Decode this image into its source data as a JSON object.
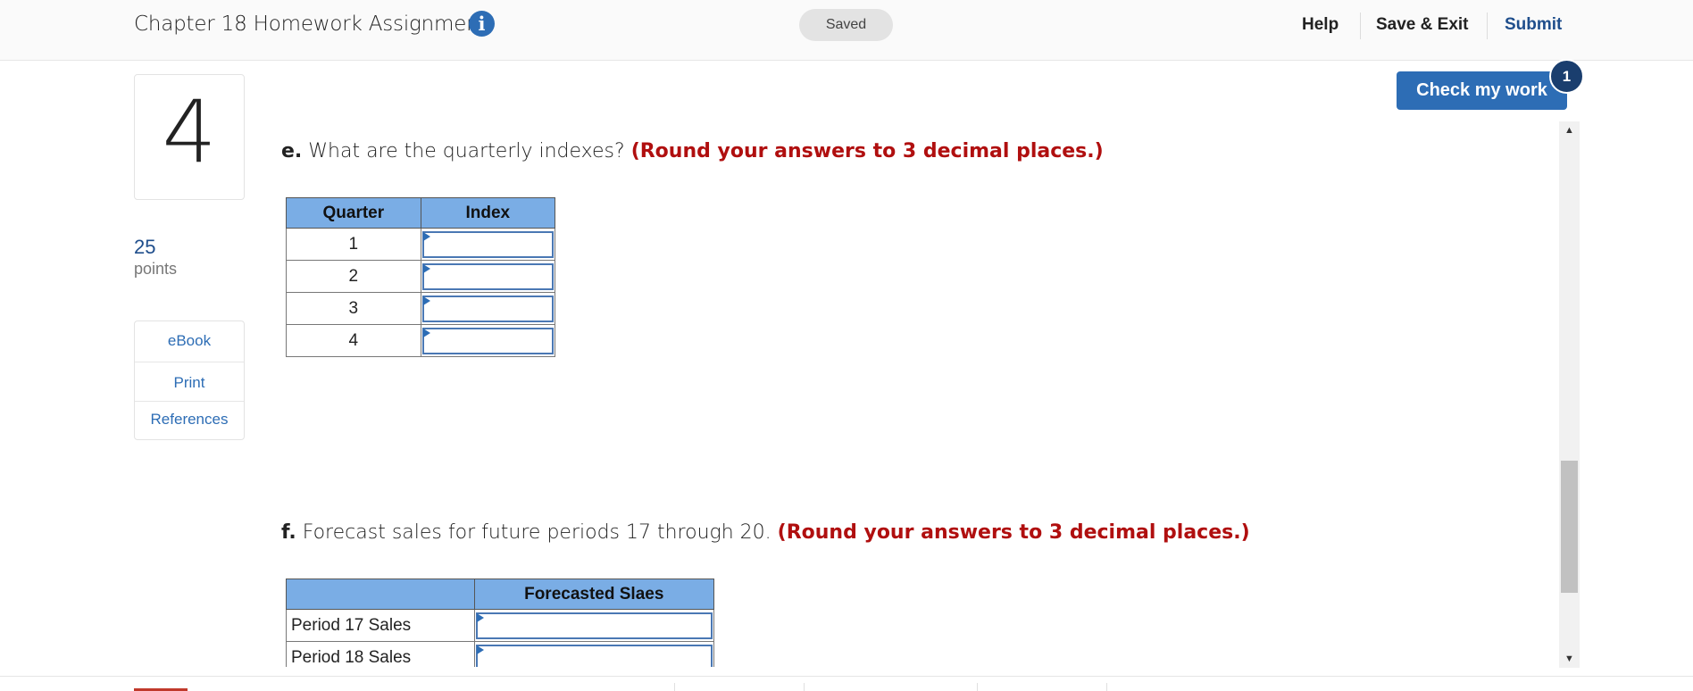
{
  "header": {
    "title": "Chapter 18 Homework Assignment",
    "info_icon": "i",
    "saved": "Saved",
    "help": "Help",
    "save_exit": "Save & Exit",
    "submit": "Submit"
  },
  "question": {
    "number": "4",
    "points_value": "25",
    "points_label": "points"
  },
  "side_links": {
    "ebook": "eBook",
    "print": "Print",
    "references": "References"
  },
  "check_work": {
    "label": "Check my work",
    "badge": "1"
  },
  "part_e": {
    "letter": "e.",
    "text": " What are the quarterly indexes? ",
    "instruction": "(Round your answers to 3 decimal places.)",
    "col_quarter": "Quarter",
    "col_index": "Index",
    "rows": [
      "1",
      "2",
      "3",
      "4"
    ]
  },
  "part_f": {
    "letter": "f.",
    "text": " Forecast sales for future periods 17 through 20. ",
    "instruction": "(Round your answers to 3 decimal places.)",
    "col_label": "",
    "col_forecast": "Forecasted Slaes",
    "rows": [
      "Period 17 Sales",
      "Period 18 Sales"
    ]
  },
  "scrollbar": {
    "up_icon": "triangle-up-icon",
    "down_icon": "triangle-down-icon"
  },
  "colors": {
    "accent": "#2d6db5",
    "instruction_red": "#b00f0f",
    "table_header": "#7aade5"
  }
}
